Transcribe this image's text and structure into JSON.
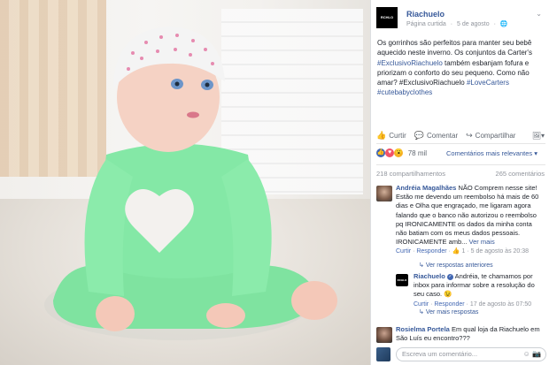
{
  "post": {
    "page_name": "Riachuelo",
    "logo_text": "RCHLO",
    "meta": [
      "Página curtida",
      "·",
      "5 de agosto",
      "·",
      "🌐"
    ],
    "text_plain": "Os gorrinhos são perfeitos para manter seu bebê aquecido neste inverno. Os conjuntos da Carter's ",
    "text_tag1": "#ExclusivoRiachuelo",
    "text_mid": " também esbanjam fofura e priorizam o conforto do seu pequeno. Como não amar? #ExclusivoRiachuelo ",
    "text_tag2": "#LoveCarters",
    "text_tag3": "#cutebabyclothes"
  },
  "actions": {
    "like": "Curtir",
    "comment": "Comentar",
    "share": "Compartilhar"
  },
  "reactions": {
    "count": "78 mil",
    "relevance": "Comentários mais relevantes ▾"
  },
  "counts": {
    "shares": "218 compartilhamentos",
    "comments": "265 comentários"
  },
  "comments": [
    {
      "name": "Andréia Magalhães",
      "text": " NÃO Comprem nesse site! Estão me devendo um reembolso há mais de 60 dias e Olha que engraçado, me ligaram agora falando que o banco não autorizou o reembolso pq IRONICAMENTE os dados da minha conta não batiam com os meus dados pessoais. IRONICAMENTE amb... ",
      "see_more": "Ver mais",
      "like": "Curtir",
      "reply": "Responder",
      "likes": "👍 1",
      "date": "5 de agosto às 20:38"
    },
    {
      "name": "Riachuelo",
      "text": " Andréia, te chamamos por inbox para informar sobre a resolução do seu caso. 😉",
      "like": "Curtir",
      "reply": "Responder",
      "date": "17 de agosto às 07:50"
    },
    {
      "name": "Rosielma Portela",
      "text": " Em qual loja da Riachuelo em São Luís eu encontro???"
    }
  ],
  "replies": {
    "previous": "Ver respostas anteriores",
    "more": "Ver mais respostas"
  },
  "composer": {
    "placeholder": "Escreva um comentário...",
    "icons": "☺ 📷"
  }
}
